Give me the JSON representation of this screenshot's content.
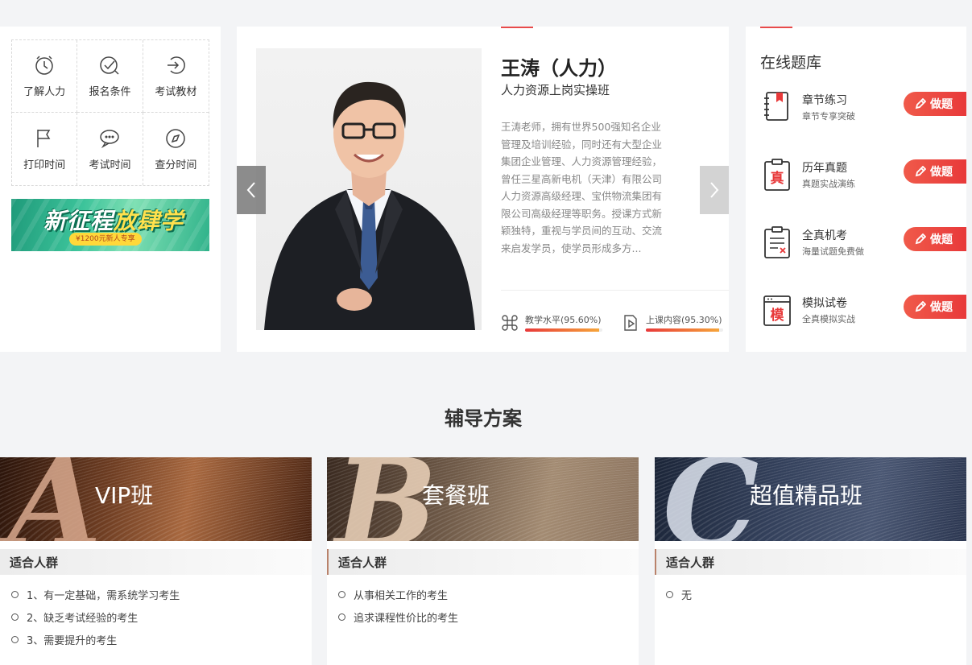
{
  "quick_links": [
    {
      "label": "了解人力",
      "icon": "clock-icon"
    },
    {
      "label": "报名条件",
      "icon": "check-badge-icon"
    },
    {
      "label": "考试教材",
      "icon": "login-icon"
    },
    {
      "label": "打印时间",
      "icon": "flag-icon"
    },
    {
      "label": "考试时间",
      "icon": "chat-icon"
    },
    {
      "label": "查分时间",
      "icon": "compass-icon"
    }
  ],
  "promo": {
    "title_part1": "新征程",
    "title_part2": "放肆学",
    "subtitle": "¥1200元新人专享"
  },
  "teacher": {
    "name": "王涛（人力）",
    "course": "人力资源上岗实操班",
    "bio": "王涛老师，拥有世界500强知名企业管理及培训经验，同时还有大型企业集团企业管理、人力资源管理经验， 曾任三星高新电机（天津）有限公司人力资源高级经理、宝供物流集团有限公司高级经理等职务。授课方式新颖独特，重视与学员间的互动、交流来启发学员，使学员形成多方...",
    "ratings": [
      {
        "label": "教学水平(95.60%)",
        "value": 95.6,
        "icon": "command-icon"
      },
      {
        "label": "上课内容(95.30%)",
        "value": 95.3,
        "icon": "play-doc-icon"
      }
    ]
  },
  "bank": {
    "title": "在线题库",
    "button_label": "做题",
    "items": [
      {
        "name": "章节练习",
        "desc": "章节专享突破",
        "icon": "notebook-icon",
        "glyph": ""
      },
      {
        "name": "历年真题",
        "desc": "真题实战演练",
        "icon": "clipboard-zhen-icon",
        "glyph": "真"
      },
      {
        "name": "全真机考",
        "desc": "海量试题免费做",
        "icon": "exam-sheet-icon",
        "glyph": ""
      },
      {
        "name": "模拟试卷",
        "desc": "全真模拟实战",
        "icon": "browser-mo-icon",
        "glyph": "模"
      }
    ]
  },
  "section_title": "辅导方案",
  "plans": [
    {
      "letter": "A",
      "name": "VIP班",
      "sub_title": "适合人群",
      "items": [
        "1、有一定基础，需系统学习考生",
        "2、缺乏考试经验的考生",
        "3、需要提升的考生"
      ]
    },
    {
      "letter": "B",
      "name": "套餐班",
      "sub_title": "适合人群",
      "items": [
        "从事相关工作的考生",
        "追求课程性价比的考生"
      ]
    },
    {
      "letter": "C",
      "name": "超值精品班",
      "sub_title": "适合人群",
      "items": [
        "无"
      ]
    }
  ]
}
